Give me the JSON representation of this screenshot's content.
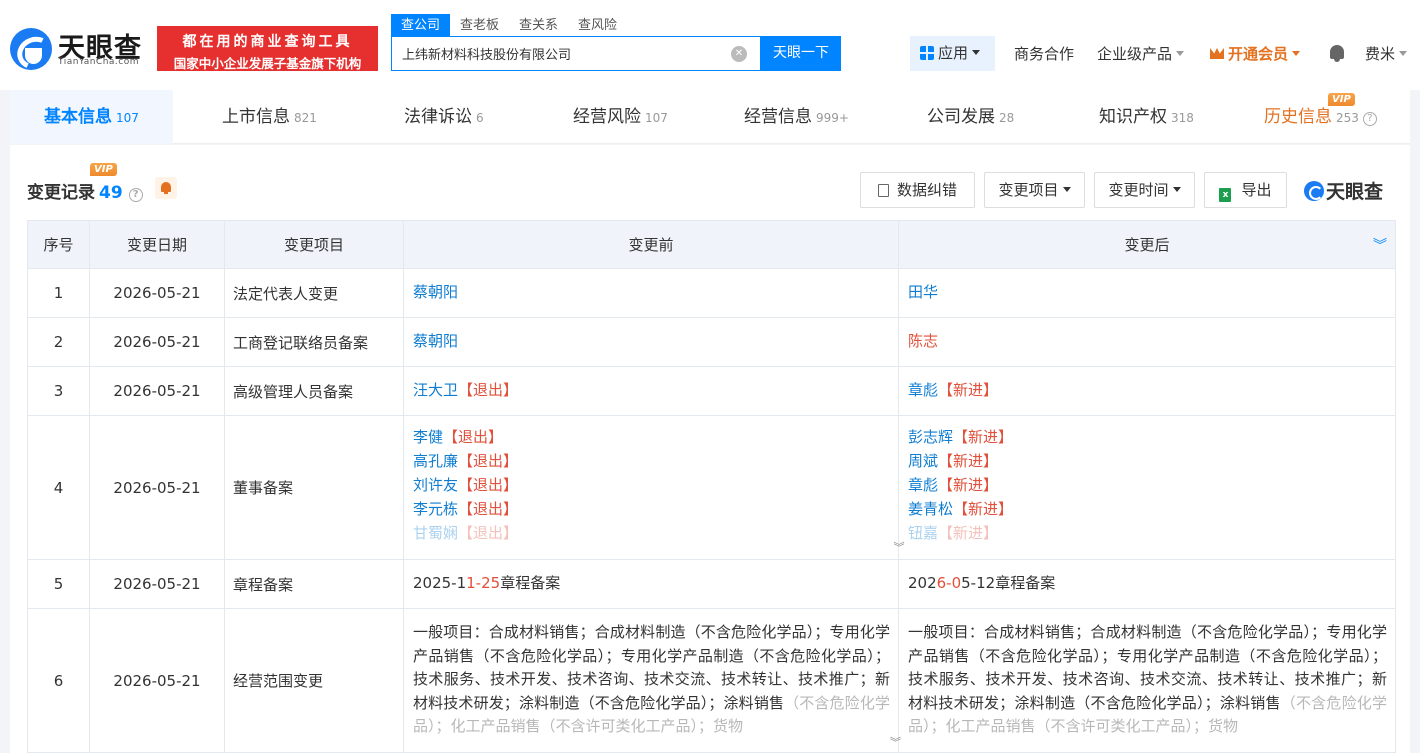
{
  "header": {
    "logo_text": "天眼查",
    "logo_domain": "TianYanCha.com",
    "slogan_line1": "都在用的商业查询工具",
    "slogan_line2": "国家中小企业发展子基金旗下机构",
    "search_tabs": [
      "查公司",
      "查老板",
      "查关系",
      "查风险"
    ],
    "search_value": "上纬新材料科技股份有限公司",
    "search_button": "天眼一下",
    "nav": {
      "apps": "应用",
      "business": "商务合作",
      "enterprise": "企业级产品",
      "vip": "开通会员",
      "user": "费米"
    }
  },
  "tabs": [
    {
      "label": "基本信息",
      "count": "107"
    },
    {
      "label": "上市信息",
      "count": "821"
    },
    {
      "label": "法律诉讼",
      "count": "6"
    },
    {
      "label": "经营风险",
      "count": "107"
    },
    {
      "label": "经营信息",
      "count": "999+"
    },
    {
      "label": "公司发展",
      "count": "28"
    },
    {
      "label": "知识产权",
      "count": "318"
    },
    {
      "label": "历史信息",
      "count": "253"
    }
  ],
  "vip_label": "VIP",
  "help_glyph": "?",
  "section": {
    "title": "变更记录",
    "count": "49",
    "buttons": {
      "data_correction": "数据纠错",
      "change_item": "变更项目",
      "change_time": "变更时间",
      "export": "导出"
    },
    "brand": "天眼查"
  },
  "table": {
    "headers": [
      "序号",
      "变更日期",
      "变更项目",
      "变更前",
      "变更后"
    ],
    "rows": [
      {
        "no": "1",
        "date": "2026-05-21",
        "item": "法定代表人变更",
        "before": "蔡朝阳",
        "after": "田华"
      },
      {
        "no": "2",
        "date": "2026-05-21",
        "item": "工商登记联络员备案",
        "before": "蔡朝阳",
        "after": "陈志"
      },
      {
        "no": "3",
        "date": "2026-05-21",
        "item": "高级管理人员备案",
        "before": "汪大卫",
        "before_tag": "【退出】",
        "after": "章彪",
        "after_tag": "【新进】"
      },
      {
        "no": "4",
        "date": "2026-05-21",
        "item": "董事备案",
        "before_list": [
          {
            "name": "李健",
            "tag": "【退出】"
          },
          {
            "name": "高孔廉",
            "tag": "【退出】"
          },
          {
            "name": "刘许友",
            "tag": "【退出】"
          },
          {
            "name": "李元栋",
            "tag": "【退出】"
          },
          {
            "name": "甘蜀娴",
            "tag": "【退出】"
          }
        ],
        "after_list": [
          {
            "name": "彭志辉",
            "tag": "【新进】"
          },
          {
            "name": "周斌",
            "tag": "【新进】"
          },
          {
            "name": "章彪",
            "tag": "【新进】"
          },
          {
            "name": "姜青松",
            "tag": "【新进】"
          },
          {
            "name": "钮嘉",
            "tag": "【新进】"
          }
        ]
      },
      {
        "no": "5",
        "date": "2026-05-21",
        "item": "章程备案",
        "before_parts": [
          "2025-1",
          "1-2",
          "5",
          "章程备案"
        ],
        "after_parts": [
          "202",
          "6-0",
          "5-12",
          "章程备案"
        ]
      },
      {
        "no": "6",
        "date": "2026-05-21",
        "item": "经营范围变更",
        "before_text": "一般项目：合成材料销售；合成材料制造（不含危险化学品）；专用化学产品销售（不含危险化学品）；专用化学产品制造（不含危险化学品）；技术服务、技术开发、技术咨询、技术交流、技术转让、技术推广；新材料技术研发；涂料制造（不含危险化学品）；涂料销售",
        "before_fade": "（不含危险化学品）；化工产品销售（不含许可类化工产品）；货物",
        "after_text": "一般项目：合成材料销售；合成材料制造（不含危险化学品）；专用化学产品销售（不含危险化学品）；专用化学产品制造（不含危险化学品）；技术服务、技术开发、技术咨询、技术交流、技术转让、技术推广；新材料技术研发；涂料制造（不含危险化学品）；涂料销售",
        "after_fade": "（不含危险化学品）；化工产品销售（不含许可类化工产品）；货物"
      }
    ]
  }
}
